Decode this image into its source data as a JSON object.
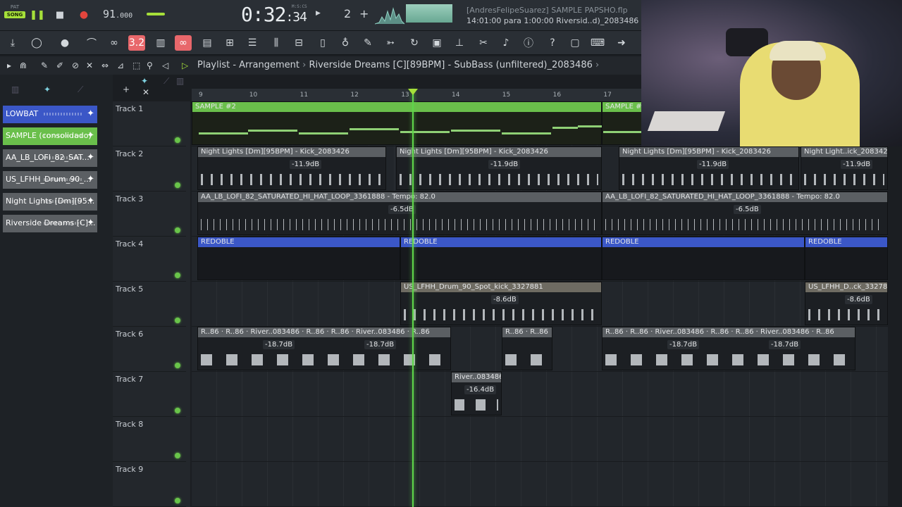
{
  "transport": {
    "mode_pat": "PAT",
    "mode_song": "SONG",
    "tempo": "91",
    "tempo_frac": ".000",
    "time_main": "0:32",
    "time_small": ":34",
    "time_unit": "M:S:CS",
    "step": "2"
  },
  "project": {
    "author_file": "[AndresFelipeSuarez]  SAMPLE PAPSHO.flp",
    "hint": "14:01:00 para 1:00:00 Riversid..d)_2083486"
  },
  "playlist": {
    "title": "Playlist - Arrangement",
    "separator": "›",
    "pattern": "Riverside Dreams [C][89BPM] - SubBass (unfiltered)_2083486",
    "end": "›"
  },
  "picker": [
    {
      "label": "LOWBAT",
      "color": "#3b57c7"
    },
    {
      "label": "SAMPLE (consolidado)",
      "color": "#6abf4b"
    },
    {
      "label": "AA_LB_LOFI_82_SAT...",
      "color": "#5b5f63"
    },
    {
      "label": "US_LFHH_Drum_90_...",
      "color": "#5b5f63"
    },
    {
      "label": "Night Lights [Dm][95...",
      "color": "#5b5f63"
    },
    {
      "label": "Riverside Dreams [C]...",
      "color": "#5b5f63"
    }
  ],
  "ruler": [
    "9",
    "10",
    "11",
    "12",
    "13",
    "14",
    "15",
    "16",
    "17"
  ],
  "tracks": [
    "Track 1",
    "Track 2",
    "Track 3",
    "Track 4",
    "Track 5",
    "Track 6",
    "Track 7",
    "Track 8",
    "Track 9"
  ],
  "clips": {
    "t1a": "SAMPLE #2",
    "t1b": "SAMPLE #",
    "t2a": "Night Lights [Dm][95BPM] - Kick_2083426",
    "t2b": "Night Lights [Dm][95BPM] - Kick_2083426",
    "t2c": "Night Lights [Dm][95BPM] - Kick_2083426",
    "t2d": "Night Light..ick_2083426",
    "t3a": "AA_LB_LOFI_82_SATURATED_HI_HAT_LOOP_3361888 - Tempo: 82.0",
    "t3b": "AA_LB_LOFI_82_SATURATED_HI_HAT_LOOP_3361888 - Tempo: 82.0",
    "t4": "REDOBLE",
    "t5a": "US_LFHH_Drum_90_Spot_kick_3327881",
    "t5b": "US_LFHH_D..ck_3327881",
    "t6r86": "R..86",
    "t6river": "River..083486",
    "t7": "River..083486"
  },
  "db": {
    "kick": "-11.9dB",
    "hat": "-6.5dB",
    "spot": "-8.6dB",
    "river": "-18.7dB",
    "t7": "-16.4dB"
  }
}
